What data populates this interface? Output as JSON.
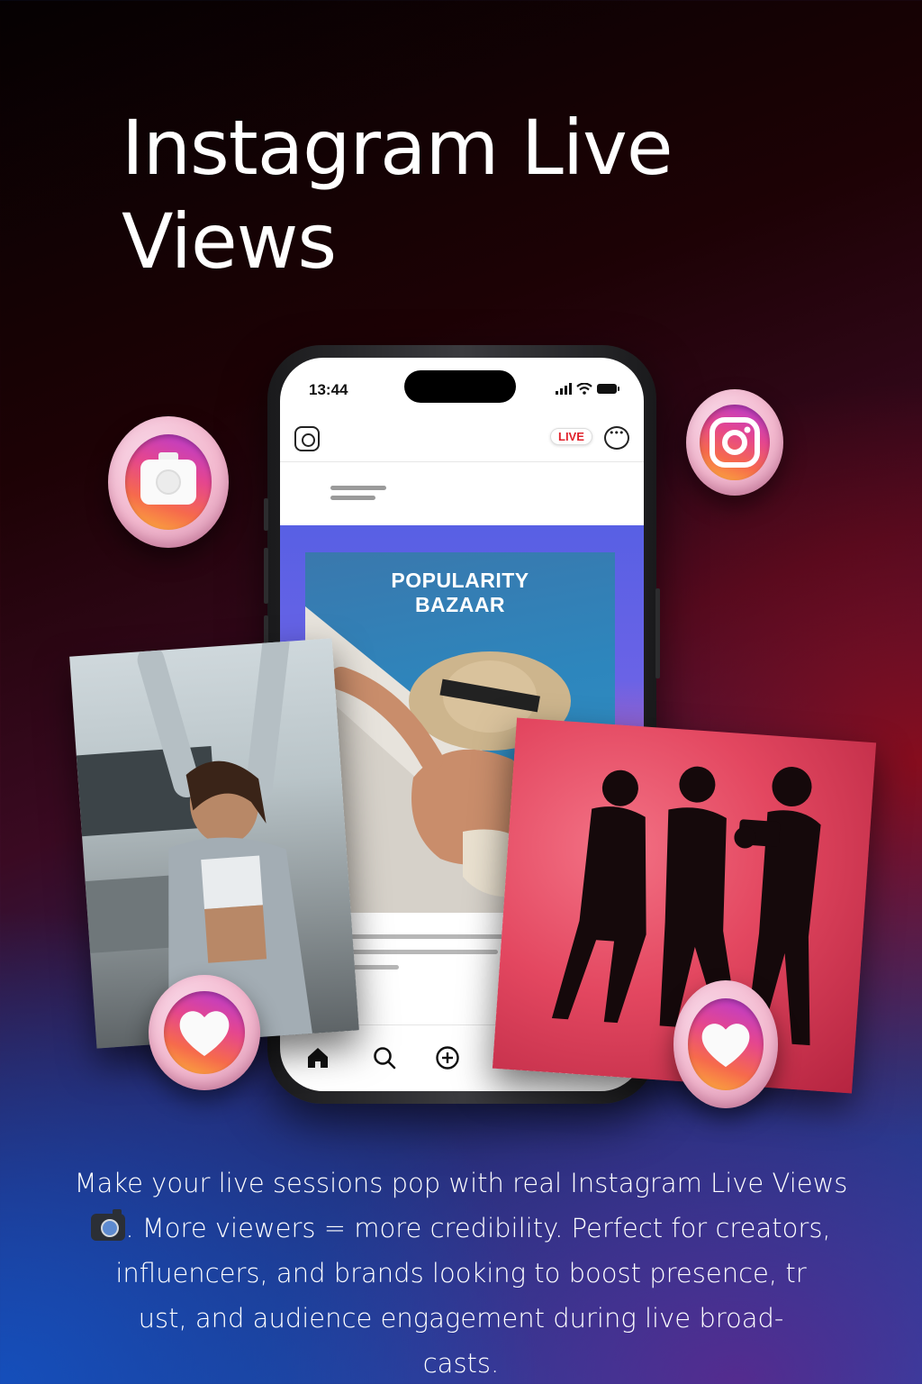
{
  "hero": {
    "title_line1": "Instagram Live",
    "title_line2": "Views"
  },
  "phone": {
    "status_time": "13:44",
    "live_badge": "LIVE",
    "post_title_line1": "POPULARITY",
    "post_title_line2": "BAZAAR",
    "nav_icons": [
      "home-icon",
      "search-icon",
      "add-post-icon"
    ]
  },
  "bubbles": [
    "camera-icon",
    "instagram-logo-icon",
    "heart-icon",
    "heart-icon"
  ],
  "description": {
    "line1": "Make your live sessions pop with real Instagram Live Views",
    "line2_after_emoji": ". More viewers = more credibility. Perfect for creators,",
    "line3": "influencers, and brands looking to boost presence, tr",
    "line4": "ust, and audience engagement during live broad-",
    "line5": "casts."
  },
  "colors": {
    "accent_gradient_start": "#b43bd8",
    "accent_gradient_mid": "#e5468e",
    "accent_gradient_end": "#fbb33a",
    "live_red": "#e0202a",
    "post_blue": "#5860e4"
  }
}
